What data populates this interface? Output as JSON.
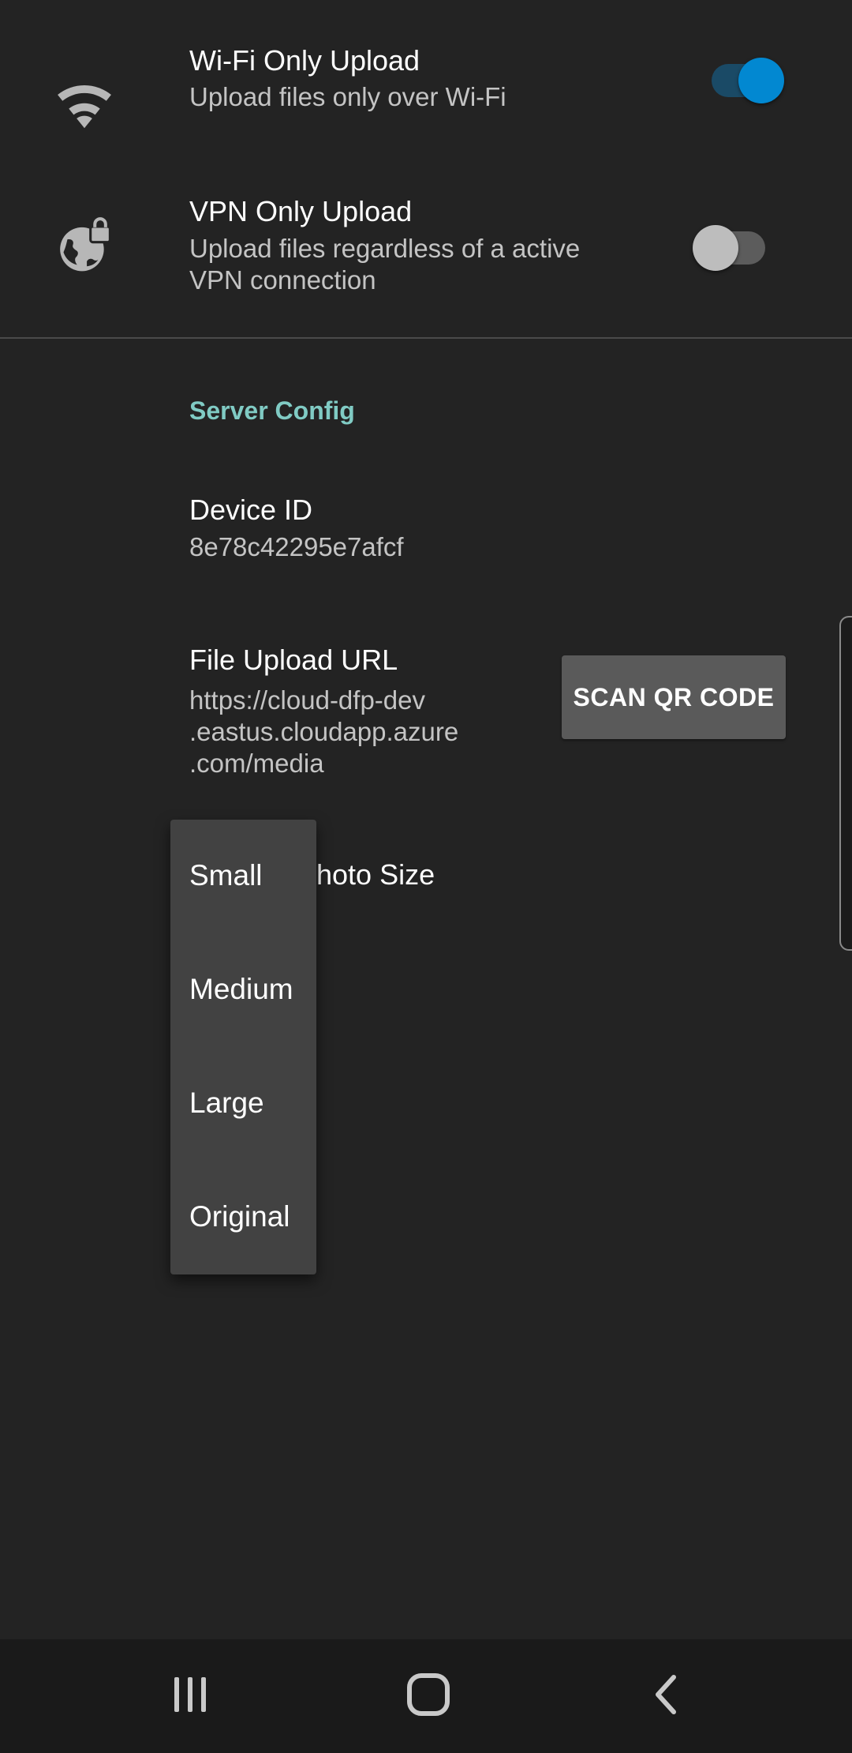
{
  "settings": {
    "wifi_only": {
      "title": "Wi-Fi Only Upload",
      "summary": "Upload files only over Wi-Fi",
      "icon": "wifi-icon",
      "enabled": true
    },
    "vpn_only": {
      "title": "VPN Only Upload",
      "summary_line1": "Upload files regardless of a active",
      "summary_line2": "VPN connection",
      "icon": "globe-lock-icon",
      "enabled": false
    },
    "server_config_header": "Server Config",
    "device_id": {
      "title": "Device ID",
      "value": "8e78c42295e7afcf"
    },
    "file_upload_url": {
      "title": "File Upload URL",
      "value_line1": "https://cloud-dfp-dev",
      "value_line2": ".eastus.cloudapp.azure",
      "value_line3": ".com/media",
      "button_label": "SCAN QR CODE"
    },
    "photo_size": {
      "title_visible": "hoto Size"
    }
  },
  "photo_size_menu": {
    "options": [
      "Small",
      "Medium",
      "Large",
      "Original"
    ]
  },
  "navbar": {
    "recents_icon": "recents-icon",
    "home_icon": "home-icon",
    "back_icon": "back-icon"
  },
  "colors": {
    "background": "#232323",
    "accent": "#0288d1",
    "section_header": "#80cbc4",
    "popup": "#424242"
  }
}
